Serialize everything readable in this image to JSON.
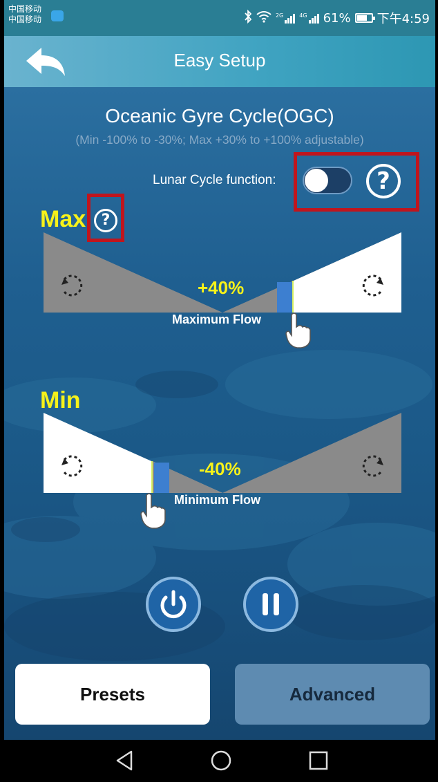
{
  "status_bar": {
    "carrier_1": "中国移动",
    "carrier_2": "中国移动",
    "net_1": "2G",
    "net_2": "4G",
    "battery": "61%",
    "time": "下午4:59"
  },
  "header": {
    "title": "Easy Setup",
    "back_icon": "back-arrow-icon"
  },
  "mode": {
    "title": "Oceanic Gyre Cycle(OGC)",
    "subtitle": "(Min -100% to -30%; Max +30% to +100% adjustable)"
  },
  "lunar": {
    "label": "Lunar Cycle function:",
    "enabled": false,
    "help_icon": "?"
  },
  "max": {
    "label": "Max",
    "help_icon": "?",
    "value": "+40%",
    "value_fraction": 0.7,
    "flow_label": "Maximum Flow",
    "left_icon": "rotate-ccw-icon",
    "right_icon": "rotate-cw-icon"
  },
  "min": {
    "label": "Min",
    "value": "-40%",
    "value_fraction": 0.3,
    "flow_label": "Minimum Flow",
    "left_icon": "rotate-ccw-icon",
    "right_icon": "rotate-cw-icon"
  },
  "controls": {
    "power_icon": "power-icon",
    "pause_icon": "pause-icon"
  },
  "buttons": {
    "presets": "Presets",
    "advanced": "Advanced"
  },
  "colors": {
    "highlight_yellow": "#f7f21a",
    "marker_blue": "#3d7fd0",
    "slider_gray": "#888888",
    "annotation_red": "#c0151d"
  }
}
